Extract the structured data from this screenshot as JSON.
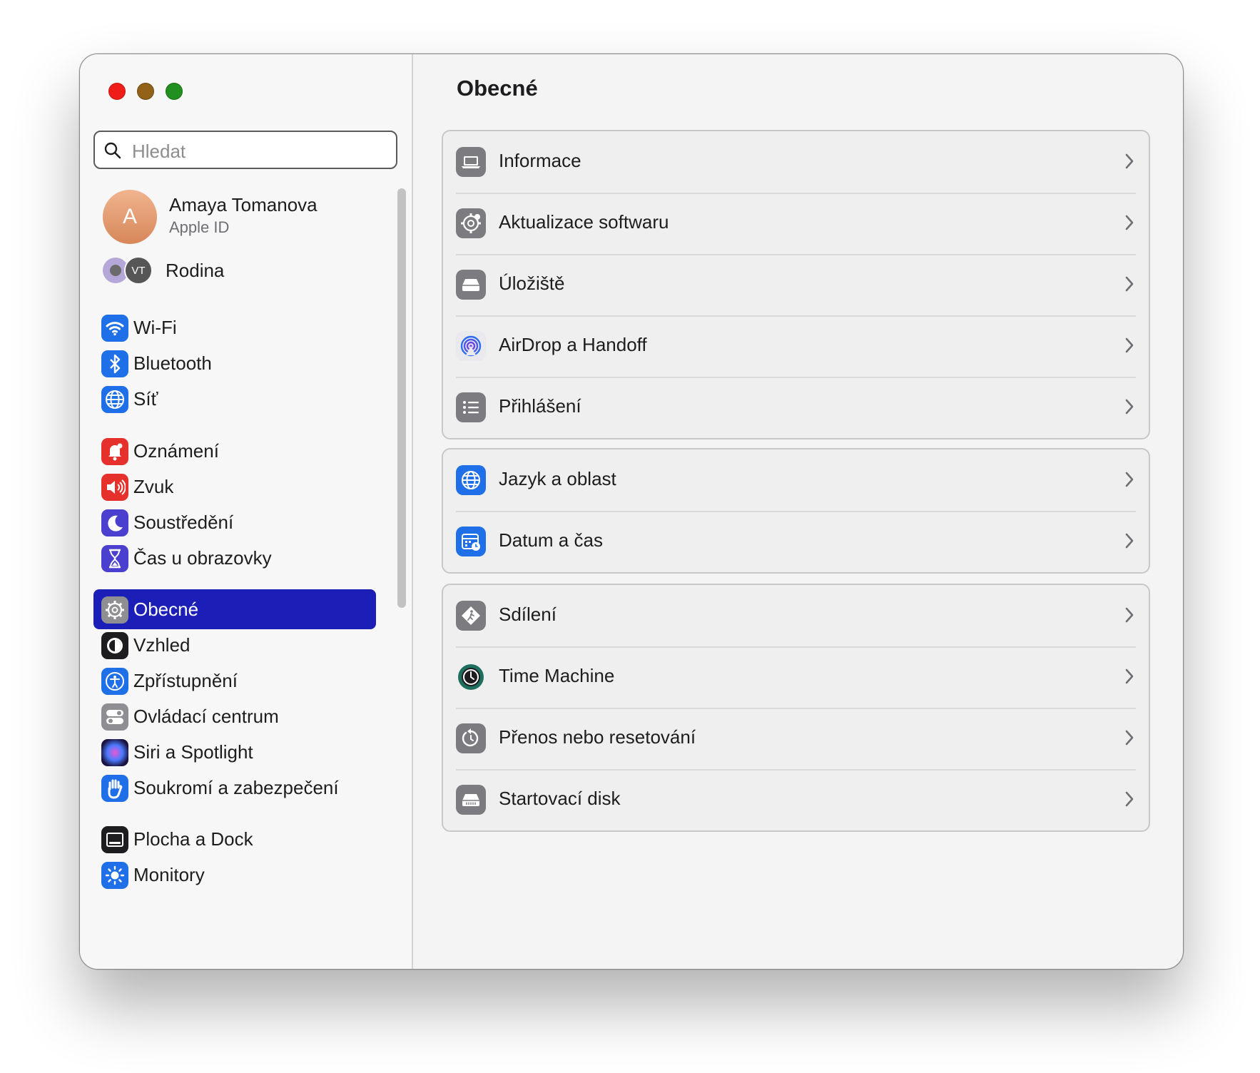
{
  "window": {
    "controls": [
      "close",
      "minimize",
      "zoom"
    ]
  },
  "sidebar": {
    "search": {
      "placeholder": "Hledat",
      "icon": "magnifying-glass-icon"
    },
    "profile": {
      "initial": "A",
      "name": "Amaya Tomanova",
      "subtitle": "Apple ID"
    },
    "family": {
      "initials": "VT",
      "label": "Rodina"
    },
    "items": [
      {
        "label": "Wi-Fi",
        "icon": "wifi-icon",
        "color": "#1f6fe8"
      },
      {
        "label": "Bluetooth",
        "icon": "bluetooth-icon",
        "color": "#1f6fe8"
      },
      {
        "label": "Síť",
        "icon": "globe-icon",
        "color": "#1f6fe8"
      },
      {
        "label": "Oznámení",
        "icon": "bell-icon",
        "color": "#e5302b"
      },
      {
        "label": "Zvuk",
        "icon": "speaker-icon",
        "color": "#e5302b"
      },
      {
        "label": "Soustředění",
        "icon": "moon-icon",
        "color": "#4a3fcf"
      },
      {
        "label": "Čas u obrazovky",
        "icon": "hourglass-icon",
        "color": "#4a3fcf"
      },
      {
        "label": "Obecné",
        "icon": "gear-icon",
        "color": "#8e8e93",
        "selected": true
      },
      {
        "label": "Vzhled",
        "icon": "appearance-icon",
        "color": "#1d1d1f"
      },
      {
        "label": "Zpřístupnění",
        "icon": "accessibility-icon",
        "color": "#1f6fe8"
      },
      {
        "label": "Ovládací centrum",
        "icon": "toggles-icon",
        "color": "#8e8e93"
      },
      {
        "label": "Siri a Spotlight",
        "icon": "siri-icon",
        "color": "#2a1a5e"
      },
      {
        "label": "Soukromí a zabezpečení",
        "icon": "hand-icon",
        "color": "#1f6fe8"
      },
      {
        "label": "Plocha a Dock",
        "icon": "dock-icon",
        "color": "#1d1d1f"
      },
      {
        "label": "Monitory",
        "icon": "sun-icon",
        "color": "#1f6fe8"
      }
    ]
  },
  "content": {
    "title": "Obecné",
    "groups": [
      [
        {
          "label": "Informace",
          "icon": "laptop-icon"
        },
        {
          "label": "Aktualizace softwaru",
          "icon": "gear-badge-icon"
        },
        {
          "label": "Úložiště",
          "icon": "drive-icon"
        },
        {
          "label": "AirDrop a Handoff",
          "icon": "airdrop-icon"
        },
        {
          "label": "Přihlášení",
          "icon": "list-icon"
        }
      ],
      [
        {
          "label": "Jazyk a oblast",
          "icon": "globe-icon"
        },
        {
          "label": "Datum a čas",
          "icon": "calendar-clock-icon"
        }
      ],
      [
        {
          "label": "Sdílení",
          "icon": "sharing-icon"
        },
        {
          "label": "Time Machine",
          "icon": "time-machine-icon"
        },
        {
          "label": "Přenos nebo resetování",
          "icon": "reset-icon"
        },
        {
          "label": "Startovací disk",
          "icon": "startup-disk-icon"
        }
      ]
    ]
  }
}
